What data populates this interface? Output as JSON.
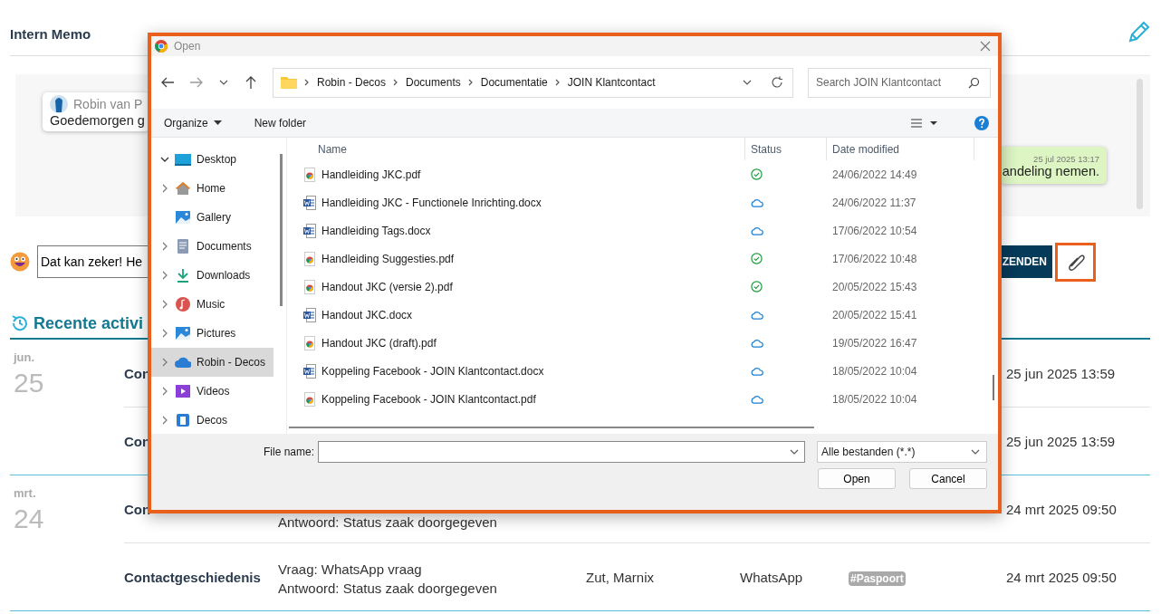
{
  "page": {
    "title": "Intern Memo"
  },
  "chat": {
    "messages": [
      {
        "kind": "incoming",
        "author": "Robin van P",
        "text": "Goedemorgen g"
      },
      {
        "kind": "outgoing",
        "time": "25 jul 2025 13:17",
        "text": "andeling nemen."
      }
    ]
  },
  "composer": {
    "value": "Dat kan zeker! He",
    "send_button": "ZENDEN"
  },
  "recent": {
    "title": "Recente activi",
    "groups": [
      {
        "month": "jun.",
        "day": "25",
        "rows": [
          {
            "type": "Con",
            "date": "25 jun 2025 13:59"
          },
          {
            "type": "Con",
            "date": "25 jun 2025 13:59"
          }
        ]
      },
      {
        "month": "mrt.",
        "day": "24",
        "rows": [
          {
            "type": "Con",
            "answer": "Antwoord: Status zaak doorgegeven",
            "date": "24 mrt 2025 09:50"
          },
          {
            "type": "Contactgeschiedenis",
            "question": "Vraag: WhatsApp vraag",
            "answer": "Antwoord: Status zaak doorgegeven",
            "name": "Zut, Marnix",
            "channel": "WhatsApp",
            "tag": "#Paspoort",
            "date": "24 mrt 2025 09:50"
          }
        ]
      }
    ]
  },
  "dialog": {
    "title": "Open",
    "path": [
      "Robin - Decos",
      "Documents",
      "Documentatie",
      "JOIN Klantcontact"
    ],
    "search": {
      "placeholder": "Search JOIN Klantcontact"
    },
    "commands": [
      "Organize",
      "New folder"
    ],
    "sidebar": [
      {
        "kind": "desktop",
        "label": "Desktop",
        "has_children": true,
        "expanded": true,
        "selected": false
      },
      {
        "kind": "home",
        "label": "Home",
        "has_children": true,
        "expanded": false,
        "selected": false
      },
      {
        "kind": "gallery",
        "label": "Gallery",
        "has_children": false,
        "expanded": false,
        "selected": false
      },
      {
        "kind": "documents",
        "label": "Documents",
        "has_children": true,
        "expanded": false,
        "selected": false
      },
      {
        "kind": "downloads",
        "label": "Downloads",
        "has_children": true,
        "expanded": false,
        "selected": false
      },
      {
        "kind": "music",
        "label": "Music",
        "has_children": true,
        "expanded": false,
        "selected": false
      },
      {
        "kind": "pictures",
        "label": "Pictures",
        "has_children": true,
        "expanded": false,
        "selected": false
      },
      {
        "kind": "cloud",
        "label": "Robin - Decos",
        "has_children": true,
        "expanded": false,
        "selected": true
      },
      {
        "kind": "videos",
        "label": "Videos",
        "has_children": true,
        "expanded": false,
        "selected": false
      },
      {
        "kind": "building",
        "label": "Decos",
        "has_children": true,
        "expanded": false,
        "selected": false
      }
    ],
    "columns": [
      "Name",
      "Status",
      "Date modified"
    ],
    "files": [
      {
        "kind": "pdf",
        "name": "Handleiding JKC.pdf",
        "synced": true,
        "date": "24/06/2022 14:49"
      },
      {
        "kind": "docx",
        "name": "Handleiding JKC - Functionele Inrichting.docx",
        "synced": false,
        "date": "24/06/2022 11:37"
      },
      {
        "kind": "docx",
        "name": "Handleiding Tags.docx",
        "synced": false,
        "date": "17/06/2022 10:54"
      },
      {
        "kind": "pdf",
        "name": "Handleiding Suggesties.pdf",
        "synced": true,
        "date": "17/06/2022 10:48"
      },
      {
        "kind": "pdf",
        "name": "Handout JKC (versie 2).pdf",
        "synced": true,
        "date": "20/05/2022 15:43"
      },
      {
        "kind": "docx",
        "name": "Handout JKC.docx",
        "synced": false,
        "date": "20/05/2022 15:41"
      },
      {
        "kind": "pdf",
        "name": "Handout JKC (draft).pdf",
        "synced": false,
        "date": "19/05/2022 16:47"
      },
      {
        "kind": "docx",
        "name": "Koppeling Facebook - JOIN Klantcontact.docx",
        "synced": false,
        "date": "18/05/2022 10:04"
      },
      {
        "kind": "pdf",
        "name": "Koppeling Facebook - JOIN Klantcontact.pdf",
        "synced": false,
        "date": "18/05/2022 10:04"
      }
    ],
    "file_name_label": "File name:",
    "filter": "Alle bestanden (*.*)",
    "buttons": [
      "Open",
      "Cancel"
    ]
  }
}
